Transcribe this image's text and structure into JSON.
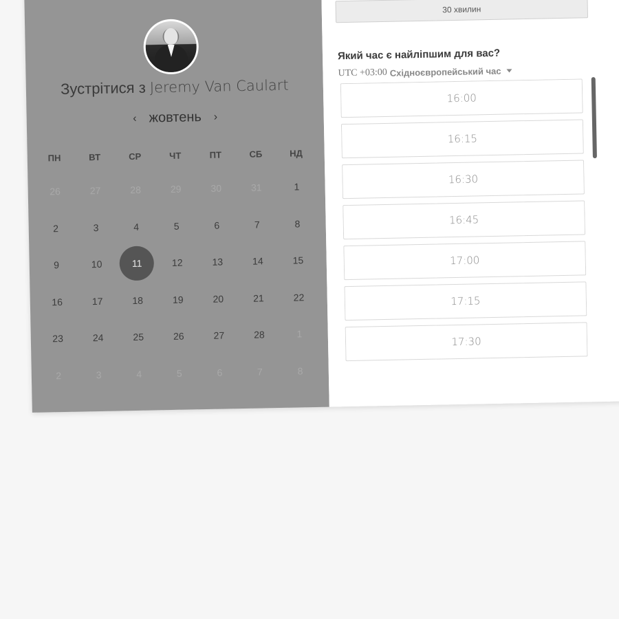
{
  "meeting": {
    "title_prefix": "Зустрітися з",
    "host": "Jeremy Van Caulart",
    "avatar_alt": "host-photo"
  },
  "calendar": {
    "month": "жовтень",
    "prev_icon": "‹",
    "next_icon": "›",
    "weekdays": [
      "ПН",
      "ВТ",
      "СР",
      "ЧТ",
      "ПТ",
      "СБ",
      "НД"
    ],
    "days": [
      {
        "n": "26",
        "muted": true
      },
      {
        "n": "27",
        "muted": true
      },
      {
        "n": "28",
        "muted": true
      },
      {
        "n": "29",
        "muted": true
      },
      {
        "n": "30",
        "muted": true
      },
      {
        "n": "31",
        "muted": true
      },
      {
        "n": "1",
        "muted": false
      },
      {
        "n": "2",
        "muted": false
      },
      {
        "n": "3",
        "muted": false
      },
      {
        "n": "4",
        "muted": false
      },
      {
        "n": "5",
        "muted": false
      },
      {
        "n": "6",
        "muted": false
      },
      {
        "n": "7",
        "muted": false
      },
      {
        "n": "8",
        "muted": false
      },
      {
        "n": "9",
        "muted": false
      },
      {
        "n": "10",
        "muted": false
      },
      {
        "n": "11",
        "muted": false,
        "selected": true
      },
      {
        "n": "12",
        "muted": false
      },
      {
        "n": "13",
        "muted": false
      },
      {
        "n": "14",
        "muted": false
      },
      {
        "n": "15",
        "muted": false
      },
      {
        "n": "16",
        "muted": false
      },
      {
        "n": "17",
        "muted": false
      },
      {
        "n": "18",
        "muted": false
      },
      {
        "n": "19",
        "muted": false
      },
      {
        "n": "20",
        "muted": false
      },
      {
        "n": "21",
        "muted": false
      },
      {
        "n": "22",
        "muted": false
      },
      {
        "n": "23",
        "muted": false
      },
      {
        "n": "24",
        "muted": false
      },
      {
        "n": "25",
        "muted": false
      },
      {
        "n": "26",
        "muted": false
      },
      {
        "n": "27",
        "muted": false
      },
      {
        "n": "28",
        "muted": false
      },
      {
        "n": "1",
        "muted": true
      },
      {
        "n": "2",
        "muted": true
      },
      {
        "n": "3",
        "muted": true
      },
      {
        "n": "4",
        "muted": true
      },
      {
        "n": "5",
        "muted": true
      },
      {
        "n": "6",
        "muted": true
      },
      {
        "n": "7",
        "muted": true
      },
      {
        "n": "8",
        "muted": true
      }
    ]
  },
  "booking": {
    "duration": "30 хвилин",
    "question": "Який час є найліпшим для вас?",
    "timezone_offset": "UTC +03:00",
    "timezone_name": "Східноєвропейський час",
    "slots": [
      "16:00",
      "16:15",
      "16:30",
      "16:45",
      "17:00",
      "17:15",
      "17:30",
      ""
    ]
  },
  "colors": {
    "left_panel": "#959595",
    "selected_day": "#555555",
    "background": "#f6f6f6"
  }
}
